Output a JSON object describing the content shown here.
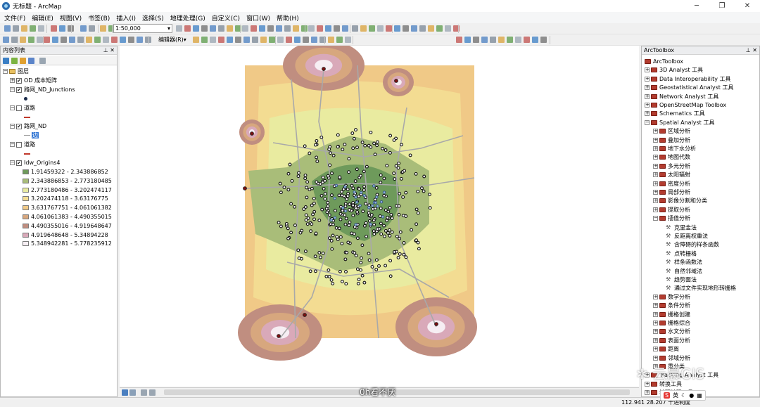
{
  "window": {
    "title": "无标题 - ArcMap"
  },
  "menu": [
    "文件(F)",
    "编辑(E)",
    "视图(V)",
    "书签(B)",
    "插入(I)",
    "选择(S)",
    "地理处理(G)",
    "自定义(C)",
    "窗口(W)",
    "帮助(H)"
  ],
  "toolbar": {
    "scale": "1:50,000",
    "editor_label": "编辑器(R)▾"
  },
  "toc": {
    "title": "内容列表",
    "root": "图层",
    "layers": [
      {
        "name": "OD 成本矩阵",
        "checked": true
      },
      {
        "name": "路网_ND_Junctions",
        "checked": true
      },
      {
        "name": "道路",
        "checked": false
      },
      {
        "name": "路网_ND",
        "checked": true
      },
      {
        "name": "道路",
        "checked": false
      },
      {
        "name": "Idw_Origins4",
        "checked": true
      }
    ],
    "edge_label": "边",
    "classes": [
      {
        "label": "1.91459322 - 2.343886852",
        "color": "#6e9a5b"
      },
      {
        "label": "2.343886853 - 2.773180485",
        "color": "#a9bd79"
      },
      {
        "label": "2.773180486 - 3.202474117",
        "color": "#e9eba0"
      },
      {
        "label": "3.202474118 - 3.63176775",
        "color": "#f3dc92"
      },
      {
        "label": "3.631767751 - 4.061061382",
        "color": "#f0c987"
      },
      {
        "label": "4.061061383 - 4.490355015",
        "color": "#d7a77e"
      },
      {
        "label": "4.490355016 - 4.919648647",
        "color": "#c08e80"
      },
      {
        "label": "4.919648648 - 5.34894228",
        "color": "#d9a9b9"
      },
      {
        "label": "5.348942281 - 5.778235912",
        "color": "#f6eef3"
      }
    ]
  },
  "arctoolbox": {
    "title": "ArcToolbox",
    "root": "ArcToolbox",
    "toolboxes": [
      "3D Analyst 工具",
      "Data Interoperability 工具",
      "Geostatistical Analyst 工具",
      "Network Analyst 工具",
      "OpenStreetMap Toolbox",
      "Schematics 工具",
      "Spatial Analyst 工具"
    ],
    "spatial_sets": [
      "区域分析",
      "叠加分析",
      "地下水分析",
      "地图代数",
      "多元分析",
      "太阳辐射",
      "密度分析",
      "局部分析",
      "影像分割和分类",
      "提取分析",
      "插值分析"
    ],
    "interp_tools": [
      "克里金法",
      "反距离权重法",
      "含障碍的样条函数",
      "点转栅格",
      "样条函数法",
      "自然邻域法",
      "趋势面法",
      "通过文件实现地形转栅格"
    ],
    "more_sets": [
      "数学分析",
      "条件分析",
      "栅格创建",
      "栅格综合",
      "水文分析",
      "表面分析",
      "距离",
      "邻域分析",
      "重分类"
    ],
    "after": [
      "Tracking Analyst 工具",
      "转换工具",
      "地理编码工具"
    ]
  },
  "status": {
    "coords": "112.941  28.207 十进制度"
  },
  "overlay": {
    "caption": "0h看不厌",
    "watermark": "云晨GIS",
    "ime": "英"
  }
}
